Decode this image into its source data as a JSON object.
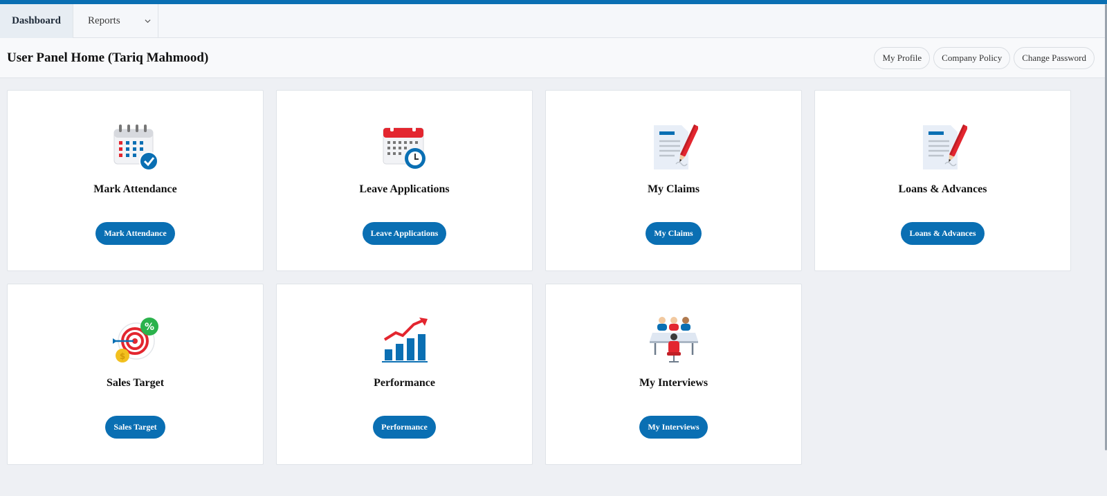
{
  "nav": {
    "tabs": [
      {
        "label": "Dashboard"
      },
      {
        "label": "Reports"
      }
    ]
  },
  "header": {
    "title": "User Panel Home (Tariq Mahmood)",
    "buttons": [
      "My Profile",
      "Company Policy",
      "Change Password"
    ]
  },
  "cards": [
    {
      "title": "Mark Attendance",
      "button": "Mark Attendance",
      "icon": "calendar-check-icon"
    },
    {
      "title": "Leave Applications",
      "button": "Leave Applications",
      "icon": "calendar-clock-icon"
    },
    {
      "title": "My Claims",
      "button": "My Claims",
      "icon": "document-pen-icon"
    },
    {
      "title": "Loans & Advances",
      "button": "Loans & Advances",
      "icon": "document-pen-icon"
    },
    {
      "title": "Sales Target",
      "button": "Sales Target",
      "icon": "target-icon"
    },
    {
      "title": "Performance",
      "button": "Performance",
      "icon": "growth-chart-icon"
    },
    {
      "title": "My Interviews",
      "button": "My Interviews",
      "icon": "interview-icon"
    }
  ],
  "colors": {
    "accent": "#0a6fb3",
    "red": "#e3262f",
    "green": "#2bb24c"
  }
}
